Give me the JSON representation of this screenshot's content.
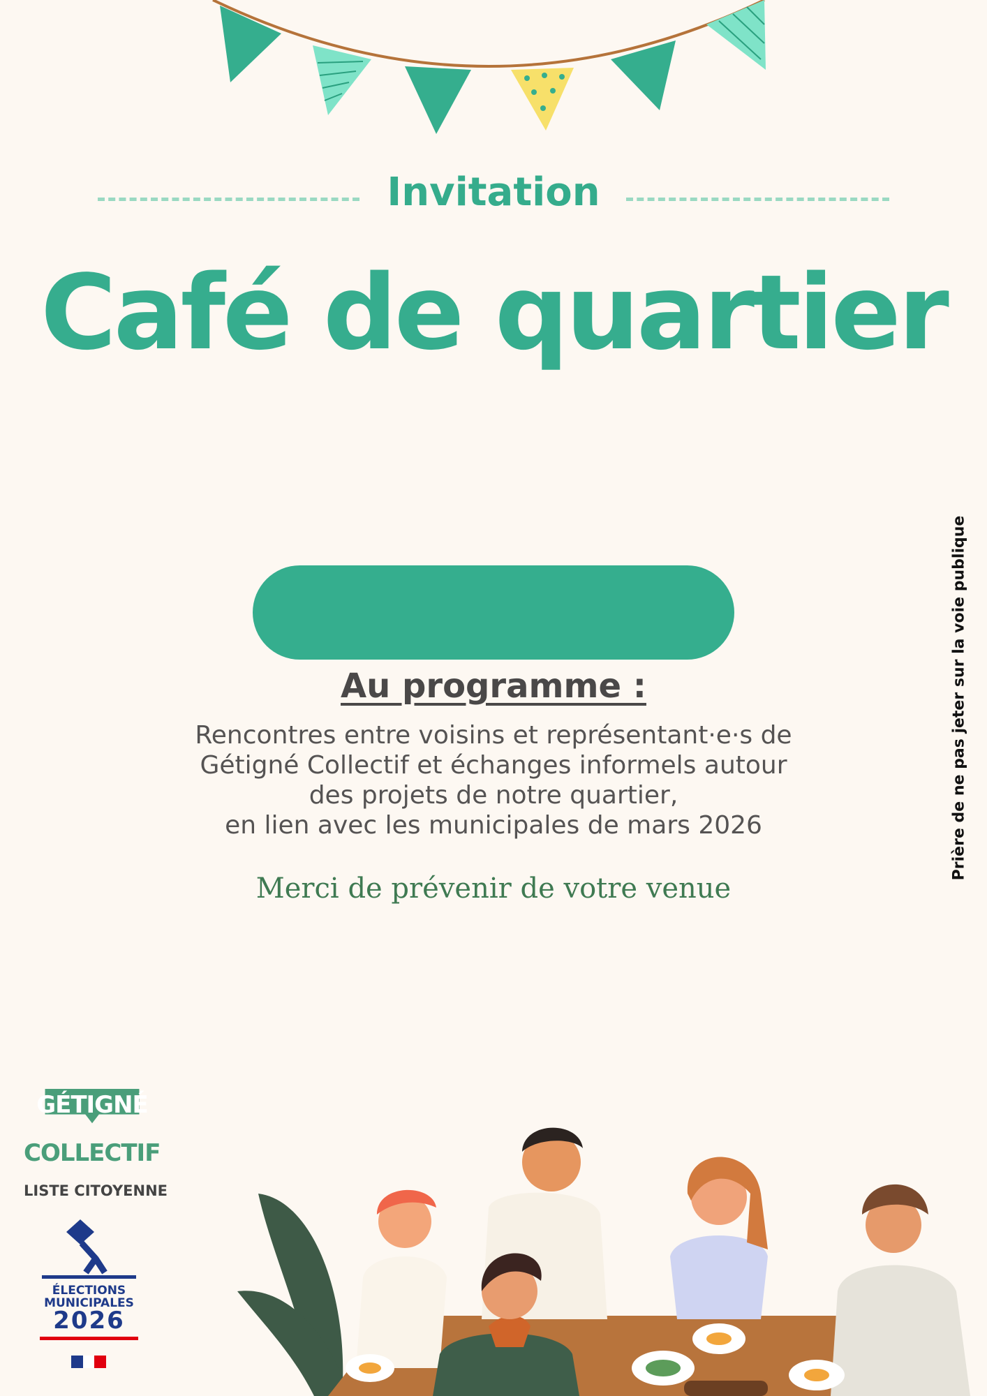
{
  "header": {
    "kicker": "Invitation",
    "title": "Café de quartier"
  },
  "event_banner": {
    "label": ""
  },
  "program": {
    "heading": "Au programme :",
    "lines": [
      "Rencontres entre voisins et représentant·e·s de",
      "Gétigné Collectif et échanges informels autour",
      "des projets de notre quartier,",
      "en lien avec les municipales de mars 2026"
    ],
    "rsvp": "Merci de prévenir de votre venue"
  },
  "side_note": "Prière de ne pas jeter sur la voie publique",
  "logo": {
    "top": "GÉTIGNÉ",
    "bottom": "COLLECTIF",
    "subtitle": "LISTE CITOYENNE"
  },
  "election_logo": {
    "line1": "ÉLECTIONS",
    "line2": "MUNICIPALES",
    "year": "2026"
  },
  "colors": {
    "background": "#fdf8f2",
    "accent_green": "#35ac8c",
    "dark_green": "#3f7a52",
    "flag_yellow": "#f7e06a",
    "text_gray": "#555353"
  }
}
